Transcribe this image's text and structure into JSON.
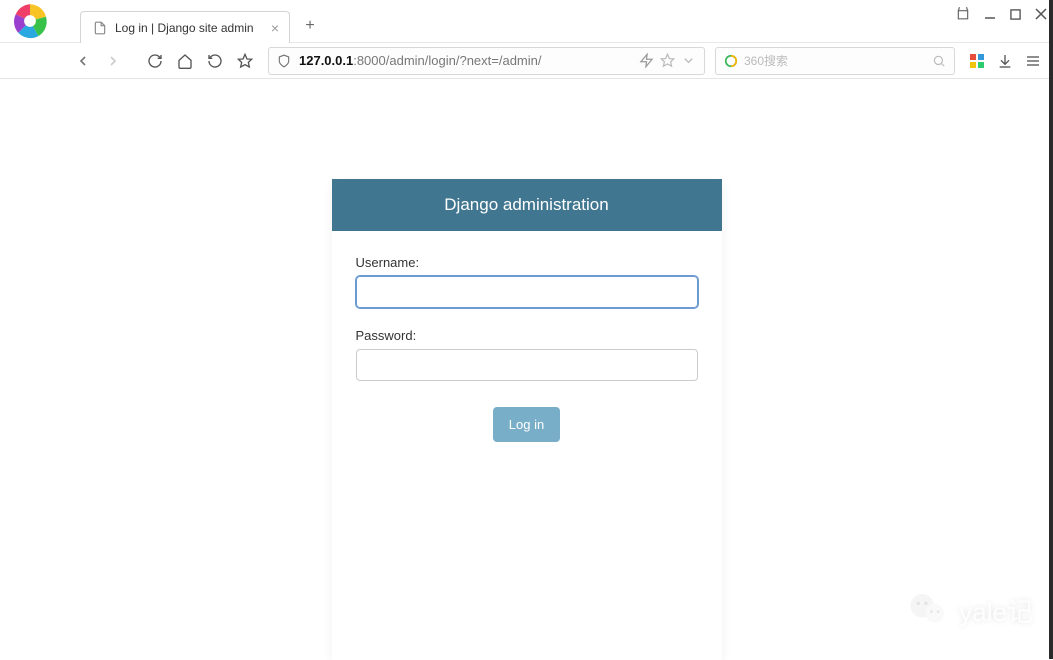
{
  "browser": {
    "tab_title": "Log in | Django site admin",
    "url_host": "127.0.0.1",
    "url_port_path": ":8000/admin/login/?next=/admin/",
    "search_placeholder": "360搜索"
  },
  "login": {
    "header": "Django administration",
    "username_label": "Username:",
    "password_label": "Password:",
    "submit_label": "Log in",
    "username_value": "",
    "password_value": ""
  },
  "watermark": {
    "text": "yale记"
  }
}
